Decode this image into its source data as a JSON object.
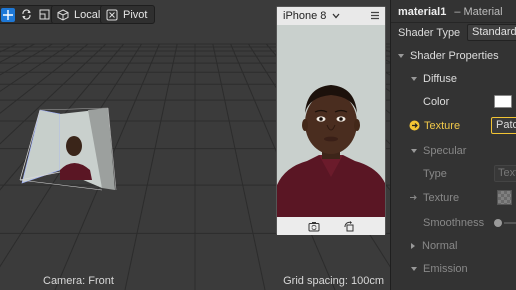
{
  "toolbar": {
    "local_label": "Local",
    "pivot_label": "Pivot"
  },
  "viewport": {
    "camera_label": "Camera: Front",
    "grid_label": "Grid spacing: 100cm"
  },
  "preview": {
    "device": "iPhone 8"
  },
  "inspector": {
    "material_name": "material1",
    "material_type": "– Material",
    "shader_type_label": "Shader Type",
    "shader_type_value": "Standard",
    "shader_properties_label": "Shader Properties",
    "diffuse_label": "Diffuse",
    "color_label": "Color",
    "texture_label": "Texture",
    "texture_value": "Patc",
    "specular_label": "Specular",
    "spec_type_label": "Type",
    "spec_type_value": "Textu",
    "spec_texture_label": "Texture",
    "smoothness_label": "Smoothness",
    "normal_label": "Normal",
    "emission_label": "Emission"
  },
  "colors": {
    "accent": "#1e78d6",
    "warning": "#f2c434",
    "panel_bg": "#333333",
    "viewport_bg": "#3b3b3b"
  }
}
